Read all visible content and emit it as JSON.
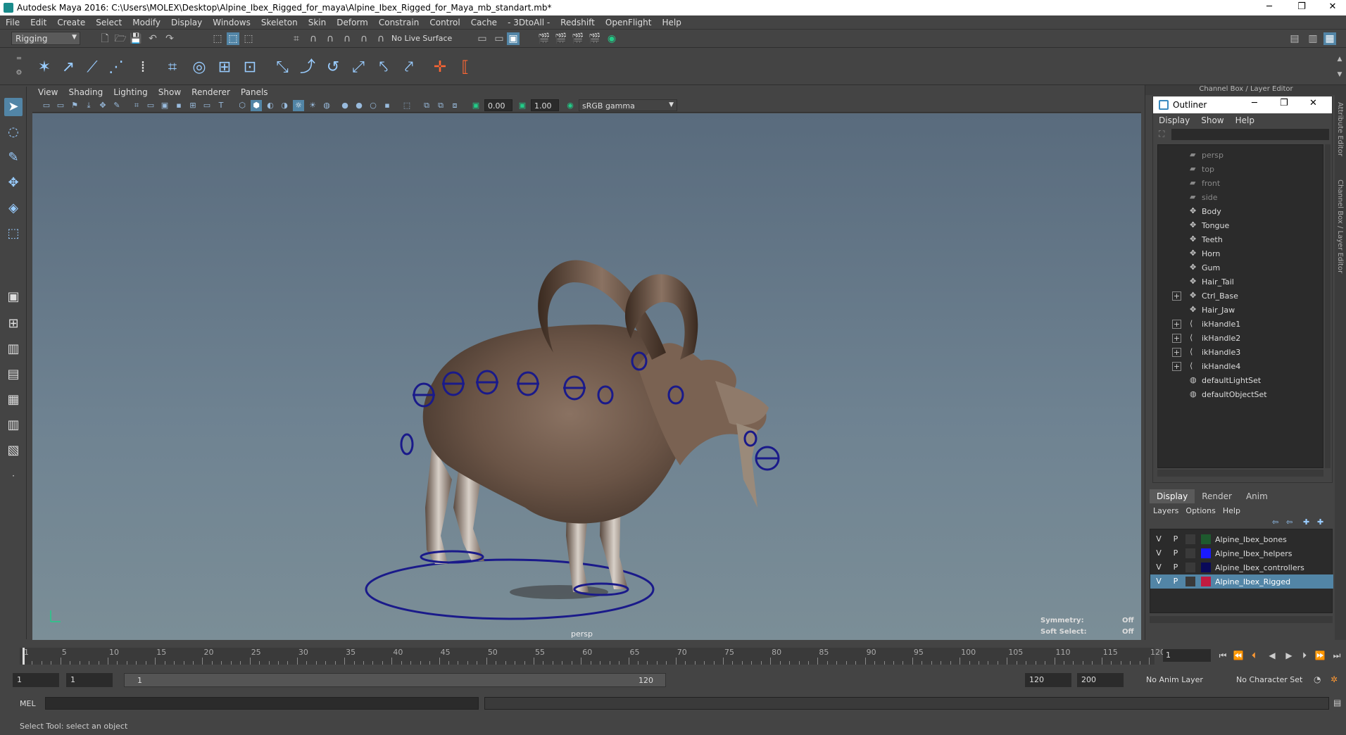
{
  "window": {
    "title": "Autodesk Maya 2016: C:\\Users\\MOLEX\\Desktop\\Alpine_Ibex_Rigged_for_maya\\Alpine_Ibex_Rigged_for_Maya_mb_standart.mb*",
    "minimize": "─",
    "restore": "❐",
    "close": "✕"
  },
  "menubar": [
    "File",
    "Edit",
    "Create",
    "Select",
    "Modify",
    "Display",
    "Windows",
    "Skeleton",
    "Skin",
    "Deform",
    "Constrain",
    "Control",
    "Cache",
    "- 3DtoAll -",
    "Redshift",
    "OpenFlight",
    "Help"
  ],
  "statusline": {
    "menuset": "Rigging",
    "live_surface": "No Live Surface"
  },
  "viewport": {
    "menu": [
      "View",
      "Shading",
      "Lighting",
      "Show",
      "Renderer",
      "Panels"
    ],
    "exposure": "0.00",
    "gamma": "1.00",
    "color_space": "sRGB gamma",
    "camera": "persp",
    "hud": {
      "symmetry_label": "Symmetry:",
      "symmetry_value": "Off",
      "soft_select_label": "Soft Select:",
      "soft_select_value": "Off"
    }
  },
  "rightpanel": {
    "title": "Channel Box / Layer Editor",
    "side_tabs": [
      "Attribute Editor",
      "Channel Box / Layer Editor"
    ]
  },
  "outliner": {
    "title": "Outliner",
    "menu": [
      "Display",
      "Show",
      "Help"
    ],
    "items": [
      {
        "name": "persp",
        "expand": false,
        "dim": true,
        "icon": "camera-icon"
      },
      {
        "name": "top",
        "expand": false,
        "dim": true,
        "icon": "camera-icon"
      },
      {
        "name": "front",
        "expand": false,
        "dim": true,
        "icon": "camera-icon"
      },
      {
        "name": "side",
        "expand": false,
        "dim": true,
        "icon": "camera-icon"
      },
      {
        "name": "Body",
        "expand": false,
        "dim": false,
        "icon": "mesh-icon"
      },
      {
        "name": "Tongue",
        "expand": false,
        "dim": false,
        "icon": "mesh-icon"
      },
      {
        "name": "Teeth",
        "expand": false,
        "dim": false,
        "icon": "mesh-icon"
      },
      {
        "name": "Horn",
        "expand": false,
        "dim": false,
        "icon": "mesh-icon"
      },
      {
        "name": "Gum",
        "expand": false,
        "dim": false,
        "icon": "mesh-icon"
      },
      {
        "name": "Hair_Tail",
        "expand": false,
        "dim": false,
        "icon": "mesh-icon"
      },
      {
        "name": "Ctrl_Base",
        "expand": true,
        "dim": false,
        "icon": "mesh-icon"
      },
      {
        "name": "Hair_Jaw",
        "expand": false,
        "dim": false,
        "icon": "mesh-icon"
      },
      {
        "name": "ikHandle1",
        "expand": true,
        "dim": false,
        "icon": "ik-icon"
      },
      {
        "name": "ikHandle2",
        "expand": true,
        "dim": false,
        "icon": "ik-icon"
      },
      {
        "name": "ikHandle3",
        "expand": true,
        "dim": false,
        "icon": "ik-icon"
      },
      {
        "name": "ikHandle4",
        "expand": true,
        "dim": false,
        "icon": "ik-icon"
      },
      {
        "name": "defaultLightSet",
        "expand": false,
        "dim": false,
        "icon": "set-icon"
      },
      {
        "name": "defaultObjectSet",
        "expand": false,
        "dim": false,
        "icon": "set-icon"
      }
    ]
  },
  "layers": {
    "tabs": [
      "Display",
      "Render",
      "Anim"
    ],
    "active_tab": "Display",
    "menu": [
      "Layers",
      "Options",
      "Help"
    ],
    "rows": [
      {
        "v": "V",
        "p": "P",
        "name": "Alpine_Ibex_bones",
        "color": "#1e5a2e",
        "selected": false
      },
      {
        "v": "V",
        "p": "P",
        "name": "Alpine_Ibex_helpers",
        "color": "#1a1aff",
        "selected": false
      },
      {
        "v": "V",
        "p": "P",
        "name": "Alpine_Ibex_controllers",
        "color": "#0a0a5a",
        "selected": false
      },
      {
        "v": "V",
        "p": "P",
        "name": "Alpine_Ibex_Rigged",
        "color": "#c01a40",
        "selected": true
      }
    ]
  },
  "timeslider": {
    "ticks": [
      "1",
      "5",
      "10",
      "15",
      "20",
      "25",
      "30",
      "35",
      "40",
      "45",
      "50",
      "55",
      "60",
      "65",
      "70",
      "75",
      "80",
      "85",
      "90",
      "95",
      "100",
      "105",
      "110",
      "115",
      "120"
    ],
    "current_frame": "1",
    "playback": [
      "⏮",
      "⏪",
      "⏴",
      "◀",
      "▶",
      "⏵",
      "⏩",
      "⏭"
    ]
  },
  "rangeslider": {
    "start": "1",
    "playback_start": "1",
    "range_start_label": "1",
    "range_end_label": "120",
    "playback_end": "120",
    "end": "200",
    "anim_layer": "No Anim Layer",
    "character_set": "No Character Set"
  },
  "cmdline": {
    "label": "MEL"
  },
  "helpline": {
    "text": "Select Tool: select an object"
  },
  "colors": {
    "accent": "#5285a6",
    "controller": "#1a1a8a"
  }
}
